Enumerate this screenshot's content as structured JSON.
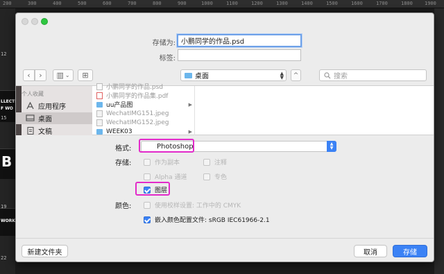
{
  "background_app": {
    "ruler_ticks": [
      "200",
      "300",
      "400",
      "500",
      "600",
      "700",
      "800",
      "900",
      "1000",
      "1100",
      "1200",
      "1300",
      "1400",
      "1500",
      "1600",
      "1700",
      "1800",
      "1900"
    ],
    "strip_labels": [
      "12",
      "15",
      "19",
      "22"
    ],
    "thumb_texts": [
      "LLECTI",
      "F WO",
      "B",
      "WORK"
    ]
  },
  "dialog": {
    "save_as_label": "存储为:",
    "save_as_value": "小鹏同学的作品.psd",
    "tags_label": "标签:",
    "tags_value": "",
    "nav": {
      "back": "‹",
      "forward": "›",
      "view_icon": "▥",
      "view_chevron": "⌄",
      "new_folder_icon": "⊞",
      "collapse": "^"
    },
    "location": "桌面",
    "search_placeholder": "搜索"
  },
  "sidebar": {
    "section": "个人收藏",
    "items": [
      {
        "label": "应用程序",
        "icon": "applications-icon",
        "selected": false
      },
      {
        "label": "桌面",
        "icon": "desktop-icon",
        "selected": true
      },
      {
        "label": "文稿",
        "icon": "documents-icon",
        "selected": false
      }
    ]
  },
  "files": [
    {
      "name": "小鹏同学的作品.psd",
      "type": "psd",
      "dir": false,
      "enabled": false
    },
    {
      "name": "小鹏同学的作品集.pdf",
      "type": "pdf",
      "dir": false,
      "enabled": false
    },
    {
      "name": "uu产品图",
      "type": "folder",
      "dir": true,
      "enabled": true
    },
    {
      "name": "WechatIMG151.jpeg",
      "type": "jpeg",
      "dir": false,
      "enabled": false
    },
    {
      "name": "WechatIMG152.jpeg",
      "type": "jpeg",
      "dir": false,
      "enabled": false
    },
    {
      "name": "WEEK03",
      "type": "folder",
      "dir": true,
      "enabled": true
    }
  ],
  "options": {
    "format_label": "格式:",
    "format_value": "Photoshop",
    "storage_label": "存储:",
    "color_label": "颜色:",
    "as_copy": {
      "label": "作为副本",
      "checked": false,
      "enabled": false
    },
    "notes": {
      "label": "注释",
      "checked": false,
      "enabled": false
    },
    "alpha": {
      "label": "Alpha 通道",
      "checked": false,
      "enabled": false
    },
    "spot": {
      "label": "专色",
      "checked": false,
      "enabled": false
    },
    "layers": {
      "label": "图层",
      "checked": true,
      "enabled": true
    },
    "proof": {
      "label": "使用校样设置: 工作中的 CMYK",
      "checked": false,
      "enabled": false
    },
    "icc": {
      "label": "嵌入颜色配置文件: sRGB IEC61966-2.1",
      "checked": true,
      "enabled": true
    }
  },
  "footer": {
    "new_folder": "新建文件夹",
    "cancel": "取消",
    "save": "存储"
  },
  "colors": {
    "accent": "#3b82f5",
    "highlight": "#e22ac9",
    "traffic_green": "#2ec740"
  }
}
